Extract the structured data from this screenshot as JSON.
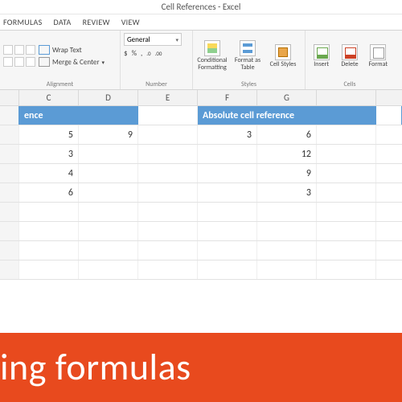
{
  "titlebar": {
    "text": "Cell References - Excel"
  },
  "tabs": {
    "formulas": "FORMULAS",
    "data": "DATA",
    "review": "REVIEW",
    "view": "VIEW"
  },
  "ribbon": {
    "alignment": {
      "label": "Alignment",
      "wrap": "Wrap Text",
      "merge": "Merge & Center"
    },
    "number": {
      "label": "Number",
      "format": "General",
      "currency": "$",
      "percent": "%",
      "comma": ",",
      "inc": ".0",
      "dec": ".00"
    },
    "styles": {
      "label": "Styles",
      "cond": "Conditional Formatting",
      "table": "Format as Table",
      "cell": "Cell Styles"
    },
    "cells": {
      "label": "Cells",
      "insert": "Insert",
      "delete": "Delete",
      "format": "Format"
    }
  },
  "columns": [
    "",
    "C",
    "D",
    "E",
    "F",
    "G",
    ""
  ],
  "headers": {
    "left": "ence",
    "right": "Absolute cell reference"
  },
  "grid": [
    [
      "",
      "5",
      "9",
      "",
      "3",
      "6",
      ""
    ],
    [
      "",
      "3",
      "",
      "",
      "",
      "12",
      ""
    ],
    [
      "",
      "4",
      "",
      "",
      "",
      "9",
      ""
    ],
    [
      "",
      "6",
      "",
      "",
      "",
      "3",
      ""
    ],
    [
      "",
      "",
      "",
      "",
      "",
      "",
      ""
    ],
    [
      "",
      "",
      "",
      "",
      "",
      "",
      ""
    ],
    [
      "",
      "",
      "",
      "",
      "",
      "",
      ""
    ],
    [
      "",
      "",
      "",
      "",
      "",
      "",
      ""
    ]
  ],
  "banner": {
    "text": "ing formulas"
  }
}
